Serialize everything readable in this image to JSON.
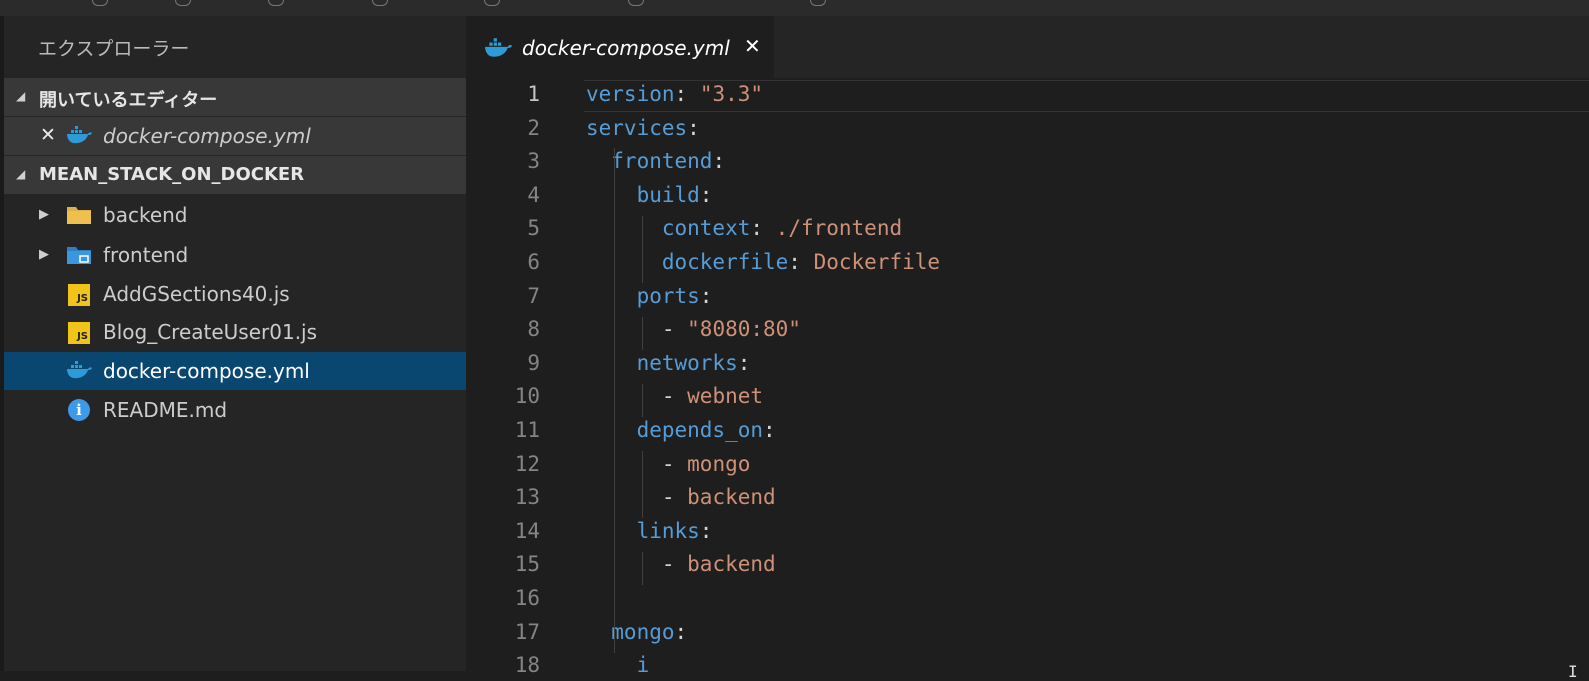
{
  "explorer": {
    "title": "エクスプローラー",
    "open_editors": {
      "header": "開いているエディター",
      "items": [
        {
          "name": "docker-compose.yml"
        }
      ]
    },
    "project": {
      "header": "MEAN_STACK_ON_DOCKER",
      "items": [
        {
          "name": "backend",
          "kind": "folder",
          "icon": "folder-icon"
        },
        {
          "name": "frontend",
          "kind": "folder",
          "icon": "folder-src-icon"
        },
        {
          "name": "AddGSections40.js",
          "kind": "js",
          "icon": "js-file-icon"
        },
        {
          "name": "Blog_CreateUser01.js",
          "kind": "js",
          "icon": "js-file-icon"
        },
        {
          "name": "docker-compose.yml",
          "kind": "docker",
          "icon": "docker-icon",
          "selected": true
        },
        {
          "name": "README.md",
          "kind": "info",
          "icon": "info-icon"
        }
      ]
    }
  },
  "editor": {
    "tab": {
      "title": "docker-compose.yml"
    },
    "line_numbers": [
      "1",
      "2",
      "3",
      "4",
      "5",
      "6",
      "7",
      "8",
      "9",
      "10",
      "11",
      "12",
      "13",
      "14",
      "15",
      "16",
      "17",
      "18"
    ],
    "lines": [
      {
        "key": "version",
        "sep": ": ",
        "value": "\"3.3\""
      },
      {
        "key": "services",
        "sep": ":",
        "value": ""
      },
      {
        "key": "  frontend",
        "sep": ":",
        "value": ""
      },
      {
        "key": "    build",
        "sep": ":",
        "value": ""
      },
      {
        "key": "      context",
        "sep": ": ",
        "value": "./frontend"
      },
      {
        "key": "      dockerfile",
        "sep": ": ",
        "value": "Dockerfile"
      },
      {
        "key": "    ports",
        "sep": ":",
        "value": ""
      },
      {
        "key": "      ",
        "sep": "- ",
        "value": "\"8080:80\""
      },
      {
        "key": "    networks",
        "sep": ":",
        "value": ""
      },
      {
        "key": "      ",
        "sep": "- ",
        "value": "webnet"
      },
      {
        "key": "    depends_on",
        "sep": ":",
        "value": ""
      },
      {
        "key": "      ",
        "sep": "- ",
        "value": "mongo"
      },
      {
        "key": "      ",
        "sep": "- ",
        "value": "backend"
      },
      {
        "key": "    links",
        "sep": ":",
        "value": ""
      },
      {
        "key": "      ",
        "sep": "- ",
        "value": "backend"
      },
      {
        "key": "",
        "sep": "",
        "value": ""
      },
      {
        "key": "  mongo",
        "sep": ":",
        "value": ""
      },
      {
        "key": "    i",
        "sep": "",
        "value": ""
      }
    ]
  },
  "colors": {
    "keyword": "#569cd6",
    "string": "#ce9178",
    "selection": "#094771"
  }
}
